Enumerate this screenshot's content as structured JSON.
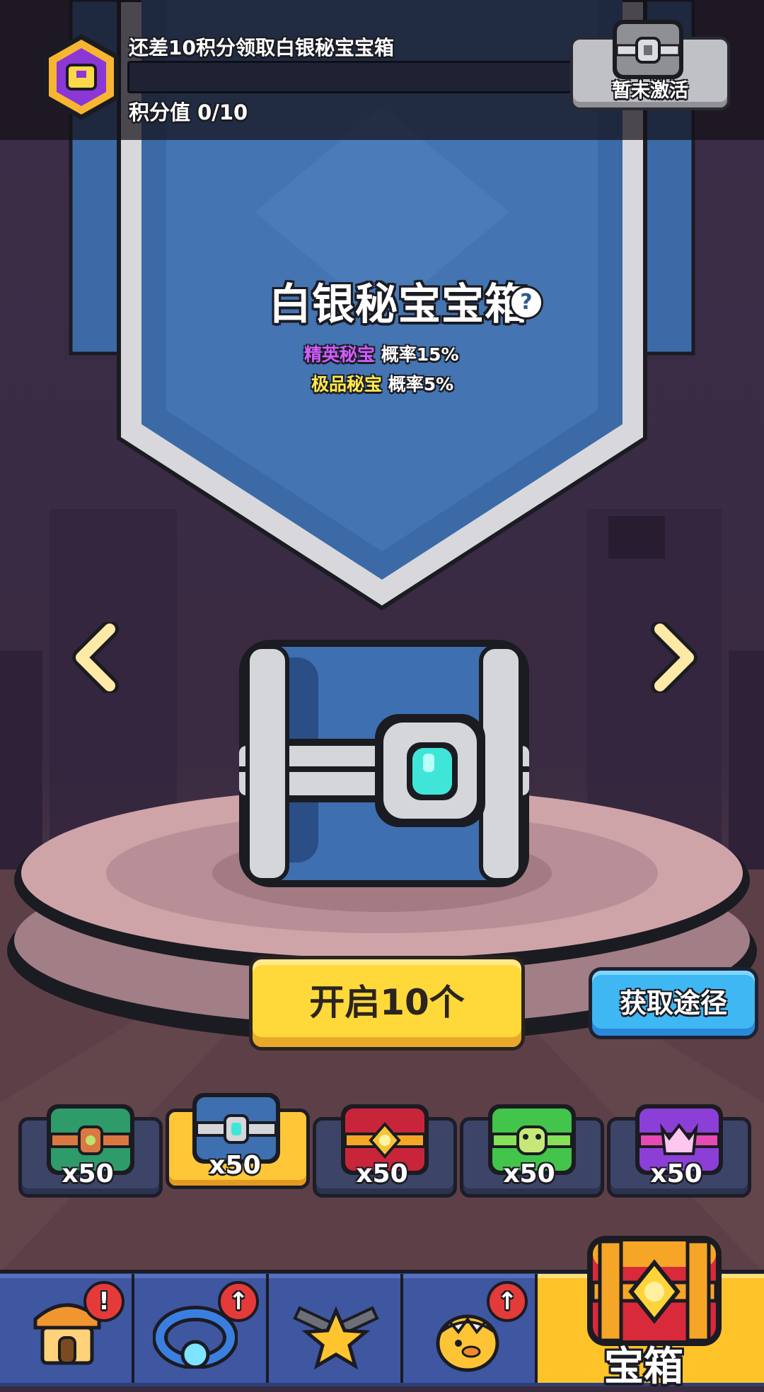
{
  "header": {
    "hint_text": "还差10积分领取白银秘宝宝箱",
    "score_text": "积分值 0/10",
    "progress": 0,
    "reward_button_label": "暂未激活",
    "badge_icon": "rank-badge-icon",
    "reward_icon": "silver-chest-icon"
  },
  "banner": {
    "title": "白银秘宝宝箱",
    "help_label": "?",
    "rates": [
      {
        "quality": "精英秘宝",
        "text": "概率15%",
        "color": "#d15cff"
      },
      {
        "quality": "极品秘宝",
        "text": "概率5%",
        "color": "#ffe94a"
      }
    ]
  },
  "navigation_arrows": {
    "prev_icon": "chevron-left-icon",
    "next_icon": "chevron-right-icon"
  },
  "actions": {
    "open_label": "开启10个",
    "obtain_label": "获取途径"
  },
  "chest_selector": [
    {
      "icon": "green-chest-icon",
      "qty": "x50",
      "selected": false
    },
    {
      "icon": "silver-chest-icon",
      "qty": "x50",
      "selected": true
    },
    {
      "icon": "red-gold-chest-icon",
      "qty": "x50",
      "selected": false
    },
    {
      "icon": "green-frog-chest-icon",
      "qty": "x50",
      "selected": false
    },
    {
      "icon": "purple-crown-chest-icon",
      "qty": "x50",
      "selected": false
    }
  ],
  "bottom_nav": {
    "tabs": [
      {
        "icon": "shop-icon",
        "alert": "!"
      },
      {
        "icon": "ring-icon",
        "alert": "↑"
      },
      {
        "icon": "weapon-star-icon",
        "alert": ""
      },
      {
        "icon": "pet-egg-icon",
        "alert": "↑"
      },
      {
        "icon": "treasure-chest-icon",
        "label": "宝箱",
        "active": true
      }
    ]
  },
  "colors": {
    "accent_yellow": "#ffd93a",
    "accent_blue": "#3fb7f2",
    "nav_blue": "#3f56a0"
  }
}
